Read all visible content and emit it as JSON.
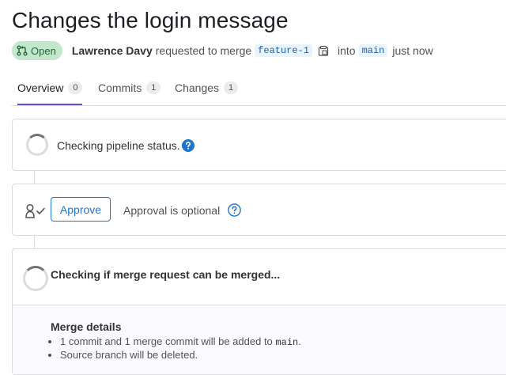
{
  "header": {
    "title": "Changes the login message",
    "status_badge": "Open",
    "author": "Lawrence Davy",
    "requested_text": "requested to merge",
    "source_branch": "feature-1",
    "into_text": "into",
    "target_branch": "main",
    "time": "just now"
  },
  "tabs": [
    {
      "label": "Overview",
      "count": "0",
      "active": true
    },
    {
      "label": "Commits",
      "count": "1",
      "active": false
    },
    {
      "label": "Changes",
      "count": "1",
      "active": false
    }
  ],
  "pipeline": {
    "status_text": "Checking pipeline status."
  },
  "approval": {
    "approve_label": "Approve",
    "optional_text": "Approval is optional"
  },
  "merge": {
    "checking_text": "Checking if merge request can be merged...",
    "details_title": "Merge details",
    "detail_1_text": "1 commit and 1 merge commit will be added to",
    "detail_1_branch": "main",
    "detail_1_suffix": ".",
    "detail_2_text": "Source branch will be deleted."
  },
  "colors": {
    "accent": "#6e49cb",
    "link": "#1f75cb",
    "open_badge_bg": "#c3e6cd",
    "open_badge_fg": "#24663b"
  },
  "icons": [
    "merge-request-icon",
    "copy-icon",
    "help-icon",
    "approval-users-icon",
    "spinner-icon"
  ]
}
